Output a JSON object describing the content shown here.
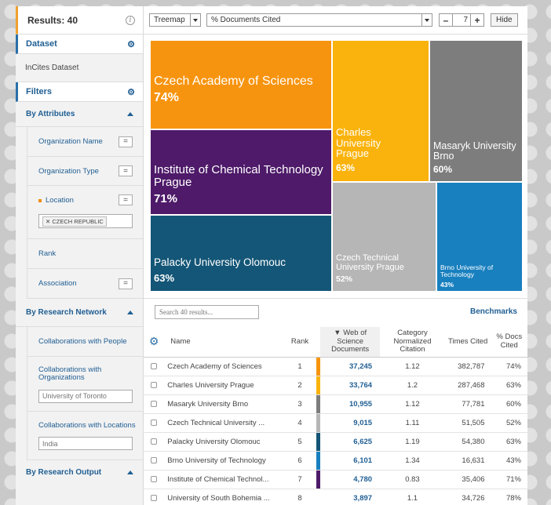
{
  "sidebar": {
    "results_label": "Results: 40",
    "dataset_title": "Dataset",
    "dataset_value": "InCites Dataset",
    "filters_title": "Filters",
    "by_attributes": "By Attributes",
    "attributes": [
      {
        "label": "Organization Name"
      },
      {
        "label": "Organization Type"
      },
      {
        "label": "Location"
      },
      {
        "label": "Rank"
      },
      {
        "label": "Association"
      }
    ],
    "eq_label": "=",
    "location_tag": "CZECH REPUBLIC",
    "by_research_network": "By Research Network",
    "collab_people": "Collaborations with People",
    "collab_orgs": "Collaborations with Organizations",
    "collab_orgs_placeholder": "University of Toronto",
    "collab_locations": "Collaborations with Locations",
    "collab_locations_placeholder": "India",
    "by_research_output": "By Research Output"
  },
  "toolbar": {
    "view": "Treemap",
    "metric": "% Documents Cited",
    "minus": "–",
    "count": "7",
    "plus": "+",
    "hide": "Hide"
  },
  "treemap": [
    {
      "name": "Czech Academy of Sciences",
      "pct": "74%",
      "color": "#f7940f"
    },
    {
      "name": "Institute of Chemical Technology Prague",
      "pct": "71%",
      "color": "#4e1a69"
    },
    {
      "name": "Palacky University Olomouc",
      "pct": "63%",
      "color": "#145677"
    },
    {
      "name": "Charles University Prague",
      "pct": "63%",
      "color": "#fab30c"
    },
    {
      "name": "Masaryk University Brno",
      "pct": "60%",
      "color": "#7d7d7d"
    },
    {
      "name": "Czech Technical University Prague",
      "pct": "52%",
      "color": "#b6b6b6"
    },
    {
      "name": "Brno University of Technology",
      "pct": "43%",
      "color": "#1980bf"
    }
  ],
  "table": {
    "search_placeholder": "Search 40 results...",
    "benchmarks": "Benchmarks",
    "headers": {
      "name": "Name",
      "rank": "Rank",
      "wos": "▼ Web of Science Documents",
      "cnc": "Category Normalized Citation",
      "times": "Times Cited",
      "docs": "% Docs Cited"
    },
    "rows": [
      {
        "name": "Czech Academy of Sciences",
        "rank": "1",
        "wos": "37,245",
        "cnc": "1.12",
        "times": "382,787",
        "docs": "74%",
        "color": "#f7940f"
      },
      {
        "name": "Charles University Prague",
        "rank": "2",
        "wos": "33,764",
        "cnc": "1.2",
        "times": "287,468",
        "docs": "63%",
        "color": "#fab30c"
      },
      {
        "name": "Masaryk University Brno",
        "rank": "3",
        "wos": "10,955",
        "cnc": "1.12",
        "times": "77,781",
        "docs": "60%",
        "color": "#7d7d7d"
      },
      {
        "name": "Czech Technical University ...",
        "rank": "4",
        "wos": "9,015",
        "cnc": "1.11",
        "times": "51,505",
        "docs": "52%",
        "color": "#b6b6b6"
      },
      {
        "name": "Palacky University Olomouc",
        "rank": "5",
        "wos": "6,625",
        "cnc": "1.19",
        "times": "54,380",
        "docs": "63%",
        "color": "#145677"
      },
      {
        "name": "Brno University of Technology",
        "rank": "6",
        "wos": "6,101",
        "cnc": "1.34",
        "times": "16,631",
        "docs": "43%",
        "color": "#1980bf"
      },
      {
        "name": "Institute of Chemical Technol...",
        "rank": "7",
        "wos": "4,780",
        "cnc": "0.83",
        "times": "35,406",
        "docs": "71%",
        "color": "#4e1a69"
      },
      {
        "name": "University of South Bohemia ...",
        "rank": "8",
        "wos": "3,897",
        "cnc": "1.1",
        "times": "34,726",
        "docs": "78%",
        "color": "#ffffff"
      }
    ]
  }
}
